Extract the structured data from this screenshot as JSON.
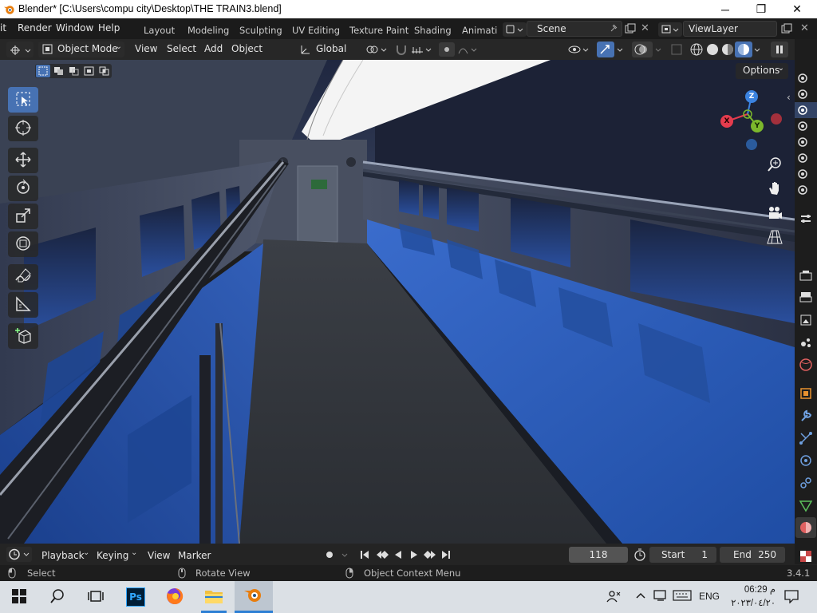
{
  "window": {
    "title": "Blender* [C:\\Users\\compu city\\Desktop\\THE TRAIN3.blend]",
    "minimize": "─",
    "maximize": "❐",
    "close": "✕"
  },
  "menu": {
    "items": [
      "it",
      "Render",
      "Window",
      "Help"
    ],
    "workspaces": [
      "Layout",
      "Modeling",
      "Sculpting",
      "UV Editing",
      "Texture Paint",
      "Shading",
      "Animati"
    ],
    "scene": "Scene",
    "view_layer": "ViewLayer"
  },
  "header": {
    "mode": "Object Mode",
    "menus": [
      "View",
      "Select",
      "Add",
      "Object"
    ],
    "transform_orientation": "Global",
    "options": "Options"
  },
  "gizmo": {
    "x": "X",
    "y": "Y",
    "z": "Z"
  },
  "timeline": {
    "menus": [
      "Playback",
      "Keying",
      "View",
      "Marker"
    ],
    "current_frame": "118",
    "start_label": "Start",
    "start": "1",
    "end_label": "End",
    "end": "250"
  },
  "status": {
    "select": "Select",
    "rotate": "Rotate View",
    "context": "Object Context Menu",
    "version": "3.4.1"
  },
  "taskbar": {
    "ps_label": "Ps",
    "lang": "ENG",
    "time": "06:29 م",
    "date": "٢٠٢٣/٠٤/٢٠"
  },
  "colors": {
    "accent": "#4772b3",
    "seat_blue": "#2c5fb8",
    "axis_x": "#e43c4e",
    "axis_y": "#7cb82c",
    "axis_z": "#3b83e0"
  }
}
